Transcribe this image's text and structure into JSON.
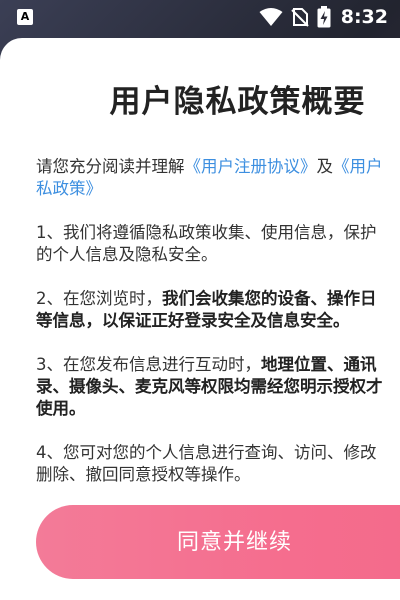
{
  "status_bar": {
    "time": "8:32",
    "left_icon": "A"
  },
  "dialog": {
    "title": "用户隐私政策概要",
    "intro": {
      "prefix": "请您充分阅读并理解",
      "link1": "《用户注册协议》",
      "middle": "及",
      "link2_line1": "《用户",
      "link2_line2": "私政策》"
    },
    "item1": {
      "line1": "1、我们将遵循隐私政策收集、使用信息，保护",
      "line2": "的个人信息及隐私安全。"
    },
    "item2": {
      "prefix": "2、在您浏览时，",
      "bold_line1": "我们会收集您的设备、操作日",
      "bold_line2": "等信息，以保证正好登录安全及信息安全。"
    },
    "item3": {
      "prefix": "3、在您发布信息进行互动时，",
      "bold_line1": "地理位置、通讯",
      "bold_line2": "录、摄像头、麦克风等权限均需经您明示授权才",
      "bold_line3": "使用。"
    },
    "item4": {
      "line1": "4、您可对您的个人信息进行查询、访问、修改",
      "line2": "删除、撤回同意授权等操作。"
    },
    "agree_button": "同意并继续"
  },
  "colors": {
    "link": "#3d8fe0",
    "button": "#f56d8e",
    "text": "#333333"
  }
}
